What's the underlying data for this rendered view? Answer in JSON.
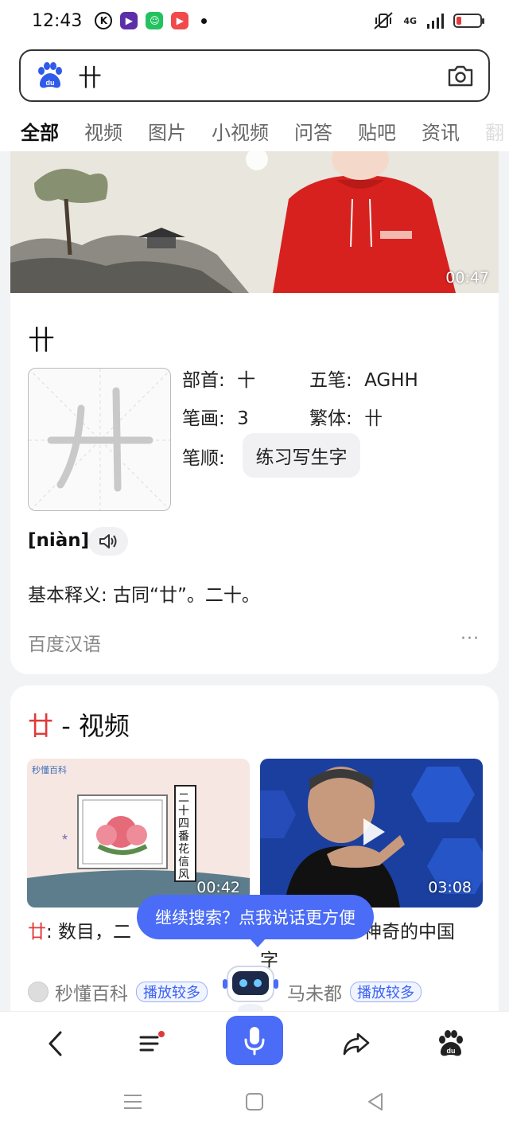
{
  "status": {
    "time": "12:43",
    "network": "4G"
  },
  "search": {
    "query": "卄"
  },
  "tabs": [
    "全部",
    "视频",
    "图片",
    "小视频",
    "问答",
    "贴吧",
    "资讯",
    "翻"
  ],
  "dict_card": {
    "video_duration": "00:47",
    "character": "卄",
    "radical_label": "部首:",
    "radical": "十",
    "wubi_label": "五笔:",
    "wubi": "AGHH",
    "strokes_label": "笔画:",
    "strokes": "3",
    "traditional_label": "繁体:",
    "traditional": "卄",
    "order_label": "笔顺:",
    "practice_button": "练习写生字",
    "pinyin": "[niàn]",
    "definition": "基本释义: 古同“廿”。二十。",
    "source": "百度汉语",
    "more": "···"
  },
  "video_section": {
    "title_char": "廿",
    "title_rest": " - 视频",
    "videos": [
      {
        "duration": "00:42",
        "scroll_text": "二十四番花信风",
        "caption_char": "廿",
        "caption_rest": ": 数目，二",
        "author": "秒懂百科",
        "badge": "播放较多"
      },
      {
        "duration": "03:08",
        "caption_rest": "神奇的中国",
        "caption_wrap": "字",
        "author": "马未都",
        "badge": "播放较多"
      }
    ]
  },
  "voice_prompt": "继续搜索？点我说话更方便",
  "colors": {
    "accent": "#4a6cf6",
    "red": "#e03a3a"
  }
}
